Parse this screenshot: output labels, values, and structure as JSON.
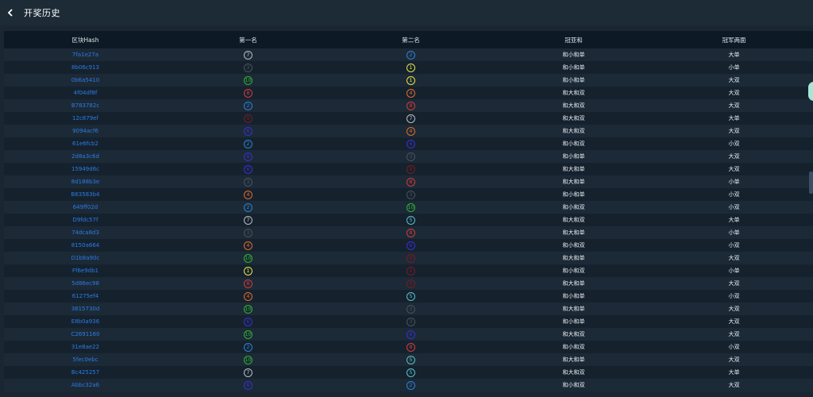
{
  "header": {
    "title": "开奖历史"
  },
  "table": {
    "headers": [
      "区块Hash",
      "第一名",
      "第二名",
      "冠亚和",
      "冠军两面"
    ],
    "rows": [
      {
        "hash": "7fa1e27a",
        "first": "7",
        "second": "2",
        "sum": "和小和单",
        "face": "大单"
      },
      {
        "hash": "8b06c913",
        "first": "3",
        "second": "1",
        "sum": "和小和单",
        "face": "小单"
      },
      {
        "hash": "0b6a5410",
        "first": "10",
        "second": "1",
        "sum": "和小和单",
        "face": "大双"
      },
      {
        "hash": "4f04df8f",
        "first": "8",
        "second": "4",
        "sum": "和大和双",
        "face": "大双"
      },
      {
        "hash": "B783782c",
        "first": "2",
        "second": "8",
        "sum": "和大和双",
        "face": "大双"
      },
      {
        "hash": "12c879ef",
        "first": "9",
        "second": "7",
        "sum": "和大和双",
        "face": "大单"
      },
      {
        "hash": "9094acf6",
        "first": "6",
        "second": "4",
        "sum": "和大和双",
        "face": "大双"
      },
      {
        "hash": "61e6fcb2",
        "first": "2",
        "second": "6",
        "sum": "和小和双",
        "face": "小双"
      },
      {
        "hash": "2d8a3c6d",
        "first": "6",
        "second": "3",
        "sum": "和小和单",
        "face": "大双"
      },
      {
        "hash": "15949d6c",
        "first": "6",
        "second": "9",
        "sum": "和大和单",
        "face": "大双"
      },
      {
        "hash": "8d188b3e",
        "first": "3",
        "second": "8",
        "sum": "和大和单",
        "face": "小单"
      },
      {
        "hash": "B63583b4",
        "first": "4",
        "second": "3",
        "sum": "和小和单",
        "face": "小双"
      },
      {
        "hash": "649ff02d",
        "first": "2",
        "second": "10",
        "sum": "和小和双",
        "face": "小双"
      },
      {
        "hash": "D9fdc57f",
        "first": "7",
        "second": "5",
        "sum": "和大和双",
        "face": "大单"
      },
      {
        "hash": "74dca8d3",
        "first": "3",
        "second": "8",
        "sum": "和大和单",
        "face": "小单"
      },
      {
        "hash": "8150a664",
        "first": "4",
        "second": "6",
        "sum": "和小和双",
        "face": "小双"
      },
      {
        "hash": "D1b8a90c",
        "first": "10",
        "second": "9",
        "sum": "和大和单",
        "face": "大双"
      },
      {
        "hash": "Ff6e9db1",
        "first": "1",
        "second": "9",
        "sum": "和小和双",
        "face": "小单"
      },
      {
        "hash": "5d86ec98",
        "first": "8",
        "second": "9",
        "sum": "和大和单",
        "face": "大双"
      },
      {
        "hash": "61275ef4",
        "first": "4",
        "second": "5",
        "sum": "和小和单",
        "face": "小双"
      },
      {
        "hash": "3815730d",
        "first": "10",
        "second": "3",
        "sum": "和大和单",
        "face": "大双"
      },
      {
        "hash": "E8b0a936",
        "first": "6",
        "second": "3",
        "sum": "和小和单",
        "face": "大双"
      },
      {
        "hash": "C2691160",
        "first": "10",
        "second": "6",
        "sum": "和大和双",
        "face": "大双"
      },
      {
        "hash": "31e8ae22",
        "first": "2",
        "second": "8",
        "sum": "和小和双",
        "face": "小双"
      },
      {
        "hash": "5fec0ebc",
        "first": "10",
        "second": "5",
        "sum": "和大和单",
        "face": "大双"
      },
      {
        "hash": "Bc425257",
        "first": "7",
        "second": "5",
        "sum": "和大和双",
        "face": "大单"
      },
      {
        "hash": "Abbc32a6",
        "first": "6",
        "second": "2",
        "sum": "和小和双",
        "face": "大双"
      }
    ]
  },
  "ball_colors": {
    "1": "#e8e34a",
    "2": "#2f7fd4",
    "3": "#4a525a",
    "4": "#e36a2a",
    "5": "#58c0c8",
    "6": "#3a2fd0",
    "7": "#b8bcc0",
    "8": "#d43a3a",
    "9": "#7a1a22",
    "10": "#2fb02f"
  }
}
